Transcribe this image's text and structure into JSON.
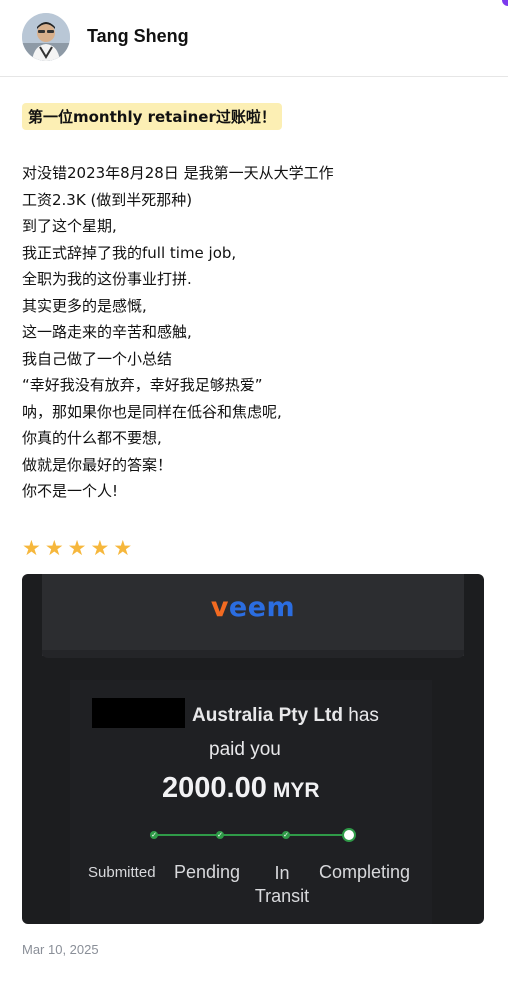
{
  "post": {
    "author_name": "Tang Sheng",
    "headline": "第一位monthly retainer过账啦！",
    "body_lines": [
      "对没错2023年8月28日 是我第一天从大学工作",
      "工资2.3K (做到半死那种)",
      "到了这个星期,",
      "我正式辞掉了我的full time job,",
      "全职为我的这份事业打拼.",
      "其实更多的是感慨,",
      "这一路走来的辛苦和感触,",
      "我自己做了一个小总结",
      "“幸好我没有放弃，幸好我足够热爱”",
      "呐，那如果你也是同样在低谷和焦虑呢,",
      "你真的什么都不要想,",
      "做就是你最好的答案！",
      "你不是一个人!"
    ],
    "rating": 5,
    "date": "Mar 10, 2025"
  },
  "payment": {
    "logo_text_v": "v",
    "logo_text_rest": "eem",
    "payer_name": "Australia Pty Ltd",
    "payer_suffix": "has",
    "paid_line": "paid you",
    "amount": "2000.00",
    "currency": "MYR",
    "steps": [
      "Submitted",
      "Pending",
      "In Transit",
      "Completing"
    ],
    "step_in": "In",
    "step_transit": "Transit"
  },
  "colors": {
    "accent_purple": "#7c3aed",
    "highlight": "#fcefb4",
    "star": "#f6b73c",
    "veem_orange": "#f26a21",
    "veem_blue": "#2b6de0",
    "progress_green": "#2f9a48"
  },
  "icons": {
    "star": "star-icon",
    "check": "check-icon"
  }
}
